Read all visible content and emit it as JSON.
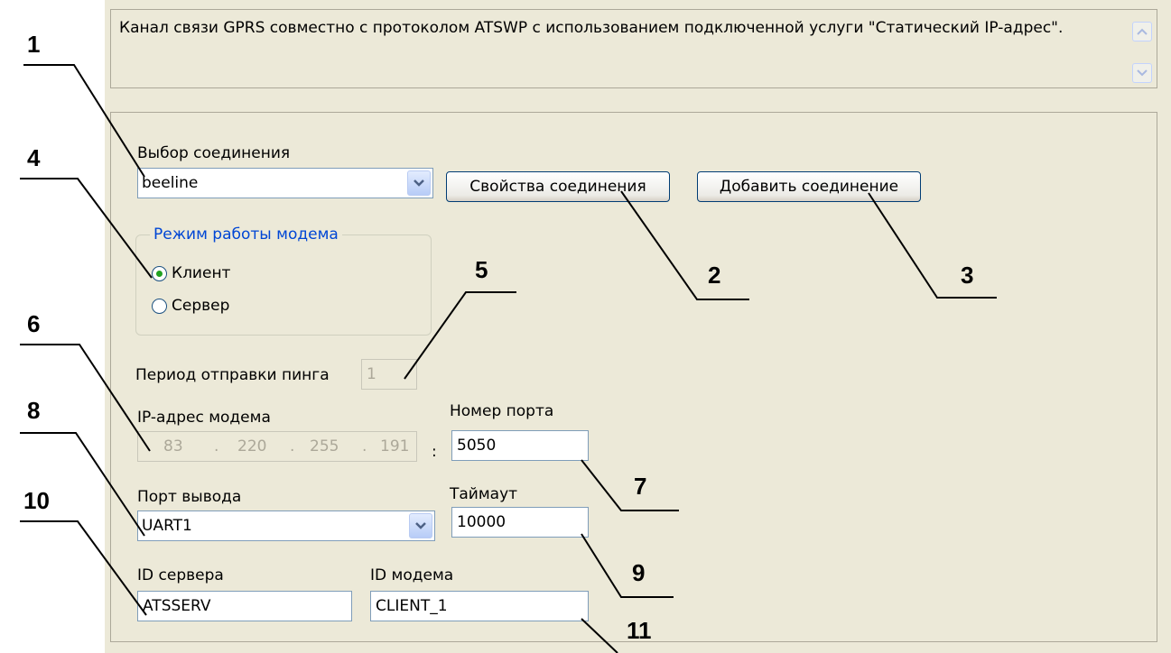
{
  "description": "Канал связи GPRS совместно с протоколом ATSWP с использованием подключенной услуги \"Статический IP-адрес\".",
  "connection": {
    "label": "Выбор соединения",
    "value": "beeline",
    "properties_button": "Свойства соединения",
    "add_button": "Добавить соединение"
  },
  "modem_mode": {
    "title": "Режим работы модема",
    "client": "Клиент",
    "server": "Сервер",
    "selected": "Клиент"
  },
  "ping": {
    "label": "Период отправки пинга",
    "value": "1"
  },
  "ip": {
    "label": "IP-адрес модема",
    "octets": [
      "83",
      "220",
      "255",
      "191"
    ],
    "separator": ":",
    "dot": "."
  },
  "port": {
    "label": "Номер порта",
    "value": "5050"
  },
  "output_port": {
    "label": "Порт вывода",
    "value": "UART1"
  },
  "timeout": {
    "label": "Таймаут",
    "value": "10000"
  },
  "server_id": {
    "label": "ID сервера",
    "value": "ATSSERV"
  },
  "modem_id": {
    "label": "ID модема",
    "value": "CLIENT_1"
  },
  "callouts": [
    "1",
    "2",
    "3",
    "4",
    "5",
    "6",
    "7",
    "8",
    "9",
    "10",
    "11"
  ],
  "colors": {
    "dialog_bg": "#ECE9D8",
    "groupbox_title": "#0046D5",
    "border": "#7F9DB9"
  }
}
